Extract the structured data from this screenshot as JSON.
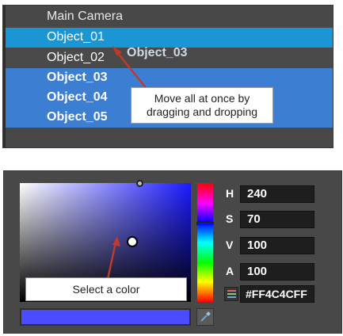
{
  "hierarchy": {
    "items": [
      {
        "label": "Main Camera"
      },
      {
        "label": "Object_01"
      },
      {
        "label": "Object_02"
      },
      {
        "label": "Object_03"
      },
      {
        "label": "Object_04"
      },
      {
        "label": "Object_05"
      }
    ],
    "drag_ghost": "Object_03",
    "callout": "Move all at once by dragging and dropping"
  },
  "color_picker": {
    "callout": "Select a color",
    "channels": {
      "h": {
        "label": "H",
        "value": "240"
      },
      "s": {
        "label": "S",
        "value": "70"
      },
      "v": {
        "label": "V",
        "value": "100"
      },
      "a": {
        "label": "A",
        "value": "100"
      }
    },
    "hex": "#FF4C4CFF",
    "swatch_color": "#4C4CFF",
    "selection_color": "#1A96D4",
    "multi_select_color": "#3C7ED2"
  },
  "icons": {
    "arrow": "red-arrow-icon",
    "eyedropper": "eyedropper-icon",
    "color_mode": "color-mode-icon"
  }
}
